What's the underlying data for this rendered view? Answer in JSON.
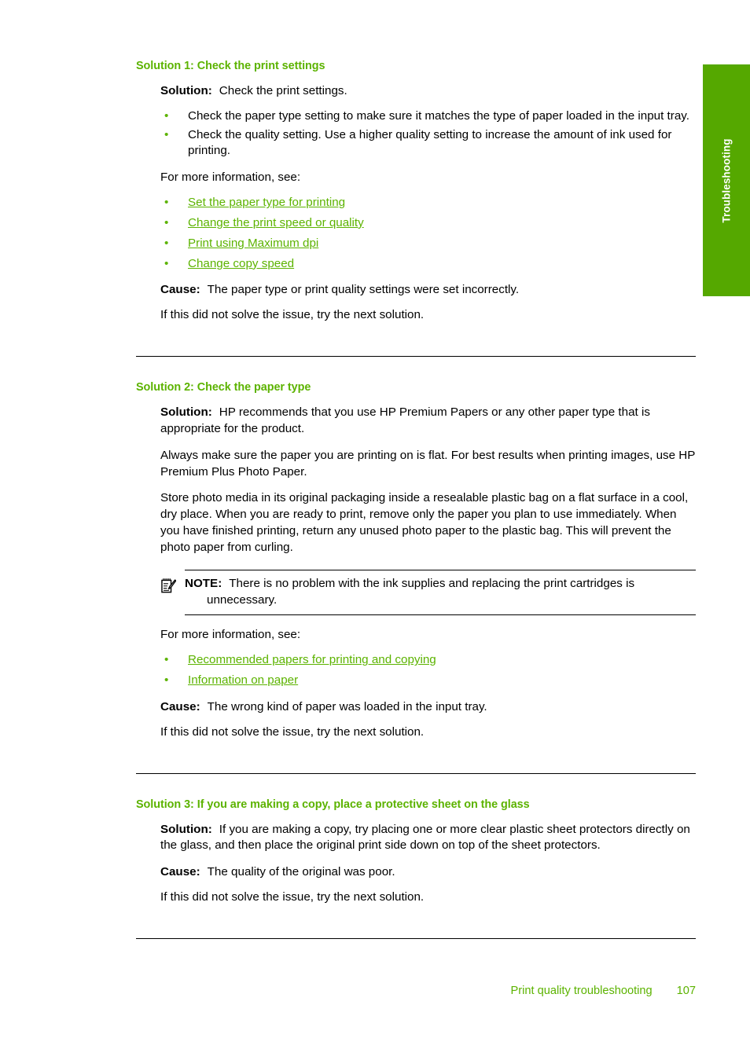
{
  "side_tab": {
    "label": "Troubleshooting",
    "color": "#55a800",
    "text_color": "#ffffff"
  },
  "theme": {
    "heading_green": "#5cb300",
    "link_green": "#5cb300",
    "bullet_green": "#5cb300",
    "body_black": "#000000"
  },
  "bullet_glyph": "•",
  "sections": [
    {
      "heading": "Solution 1: Check the print settings",
      "solution_label": "Solution:",
      "solution_text": "Check the print settings.",
      "bullets": [
        "Check the paper type setting to make sure it matches the type of paper loaded in the input tray.",
        "Check the quality setting. Use a higher quality setting to increase the amount of ink used for printing."
      ],
      "more_info_label": "For more information, see:",
      "links": [
        "Set the paper type for printing",
        "Change the print speed or quality",
        "Print using Maximum dpi",
        "Change copy speed"
      ],
      "cause_label": "Cause:",
      "cause_text": "The paper type or print quality settings were set incorrectly.",
      "next_text": "If this did not solve the issue, try the next solution."
    },
    {
      "heading": "Solution 2: Check the paper type",
      "solution_label": "Solution:",
      "solution_text": "HP recommends that you use HP Premium Papers or any other paper type that is appropriate for the product.",
      "paragraphs": [
        "Always make sure the paper you are printing on is flat. For best results when printing images, use HP Premium Plus Photo Paper.",
        "Store photo media in its original packaging inside a resealable plastic bag on a flat surface in a cool, dry place. When you are ready to print, remove only the paper you plan to use immediately. When you have finished printing, return any unused photo paper to the plastic bag. This will prevent the photo paper from curling."
      ],
      "note": {
        "icon": "note-pad-pencil-icon",
        "label": "NOTE:",
        "text": "There is no problem with the ink supplies and replacing the print cartridges is unnecessary."
      },
      "more_info_label": "For more information, see:",
      "links": [
        "Recommended papers for printing and copying",
        "Information on paper"
      ],
      "cause_label": "Cause:",
      "cause_text": "The wrong kind of paper was loaded in the input tray.",
      "next_text": "If this did not solve the issue, try the next solution."
    },
    {
      "heading": "Solution 3: If you are making a copy, place a protective sheet on the glass",
      "solution_label": "Solution:",
      "solution_text": "If you are making a copy, try placing one or more clear plastic sheet protectors directly on the glass, and then place the original print side down on top of the sheet protectors.",
      "cause_label": "Cause:",
      "cause_text": "The quality of the original was poor.",
      "next_text": "If this did not solve the issue, try the next solution."
    }
  ],
  "footer": {
    "title": "Print quality troubleshooting",
    "page_number": "107"
  }
}
